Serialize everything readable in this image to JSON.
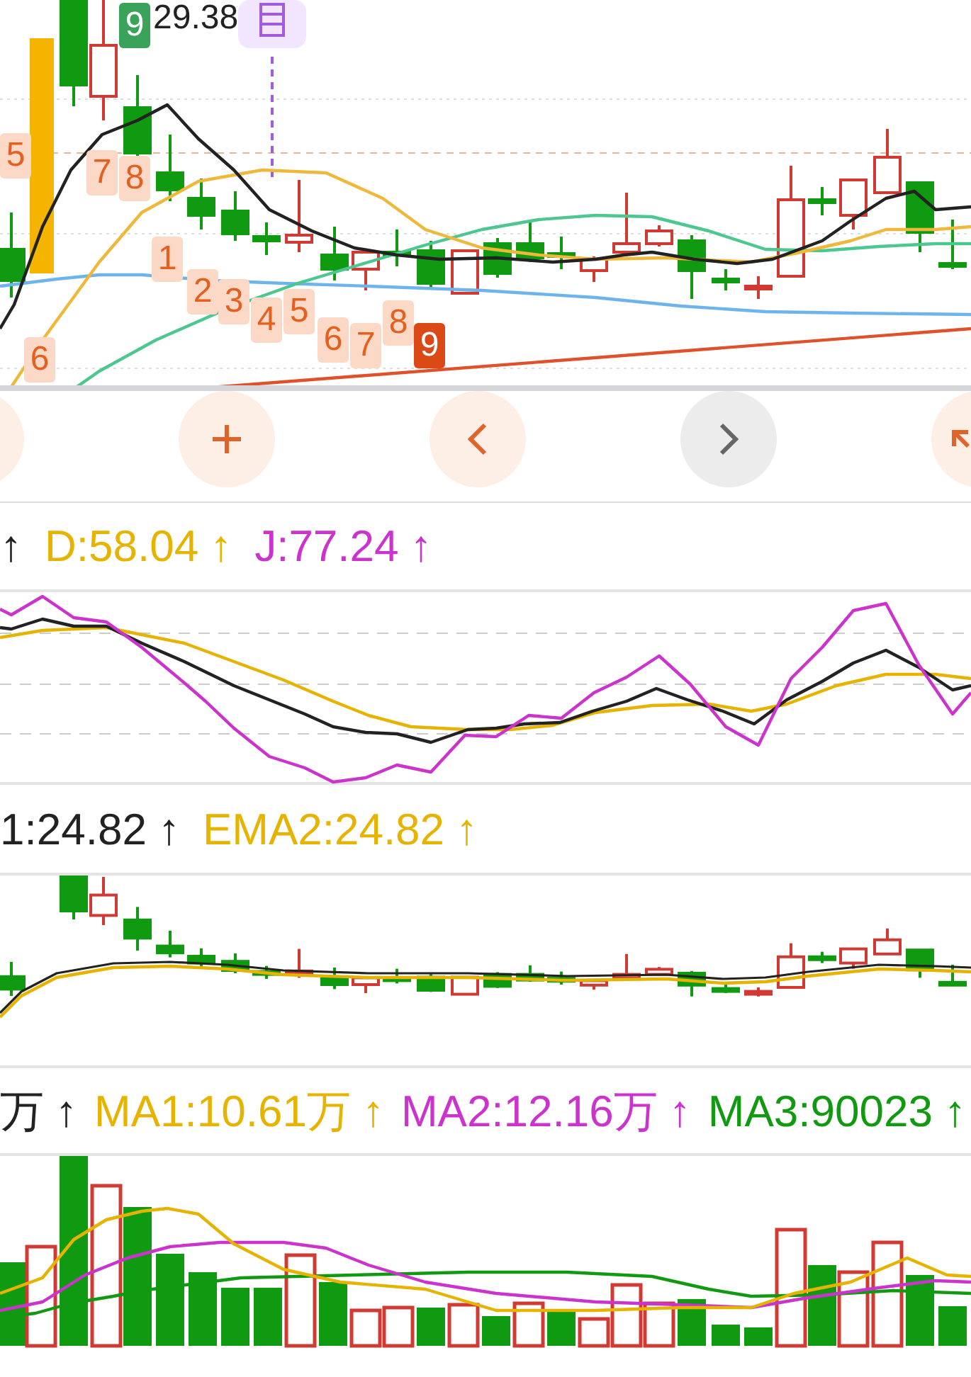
{
  "price_chart": {
    "price_label": "29.38",
    "td_labels": [
      {
        "text": "9",
        "kind": "signal"
      },
      {
        "text": "5",
        "kind": "count"
      },
      {
        "text": "7",
        "kind": "count"
      },
      {
        "text": "8",
        "kind": "count"
      },
      {
        "text": "6",
        "kind": "count"
      },
      {
        "text": "1",
        "kind": "count"
      },
      {
        "text": "2",
        "kind": "count"
      },
      {
        "text": "3",
        "kind": "count"
      },
      {
        "text": "4",
        "kind": "count"
      },
      {
        "text": "5",
        "kind": "count"
      },
      {
        "text": "6",
        "kind": "count"
      },
      {
        "text": "7",
        "kind": "count"
      },
      {
        "text": "8",
        "kind": "count"
      },
      {
        "text": "9",
        "kind": "highlight"
      }
    ]
  },
  "controls": [
    {
      "kind": "edge",
      "disabled": false
    },
    {
      "kind": "zoom-in",
      "disabled": false
    },
    {
      "kind": "previous",
      "disabled": false
    },
    {
      "kind": "next",
      "disabled": true
    },
    {
      "kind": "expand",
      "disabled": false
    }
  ],
  "kdj_legend": [
    {
      "arrow": "↑",
      "color": "#222222"
    },
    {
      "label": "D:58.04",
      "arrow": "↑",
      "color": "#e6b300"
    },
    {
      "label": "J:77.24",
      "arrow": "↑",
      "color": "#cc33cc"
    }
  ],
  "ema_legend": [
    {
      "label": "1:24.82",
      "arrow": "↑",
      "color": "#222222"
    },
    {
      "label": "EMA2:24.82",
      "arrow": "↑",
      "color": "#e6b300"
    }
  ],
  "volume_legend": [
    {
      "label": "万",
      "arrow": "↑",
      "color": "#222222"
    },
    {
      "label": "MA1:10.61万",
      "arrow": "↑",
      "color": "#e6b300"
    },
    {
      "label": "MA2:12.16万",
      "arrow": "↑",
      "color": "#cc33cc"
    },
    {
      "label": "MA3:90023",
      "arrow": "↑",
      "color": "#119911"
    }
  ]
}
